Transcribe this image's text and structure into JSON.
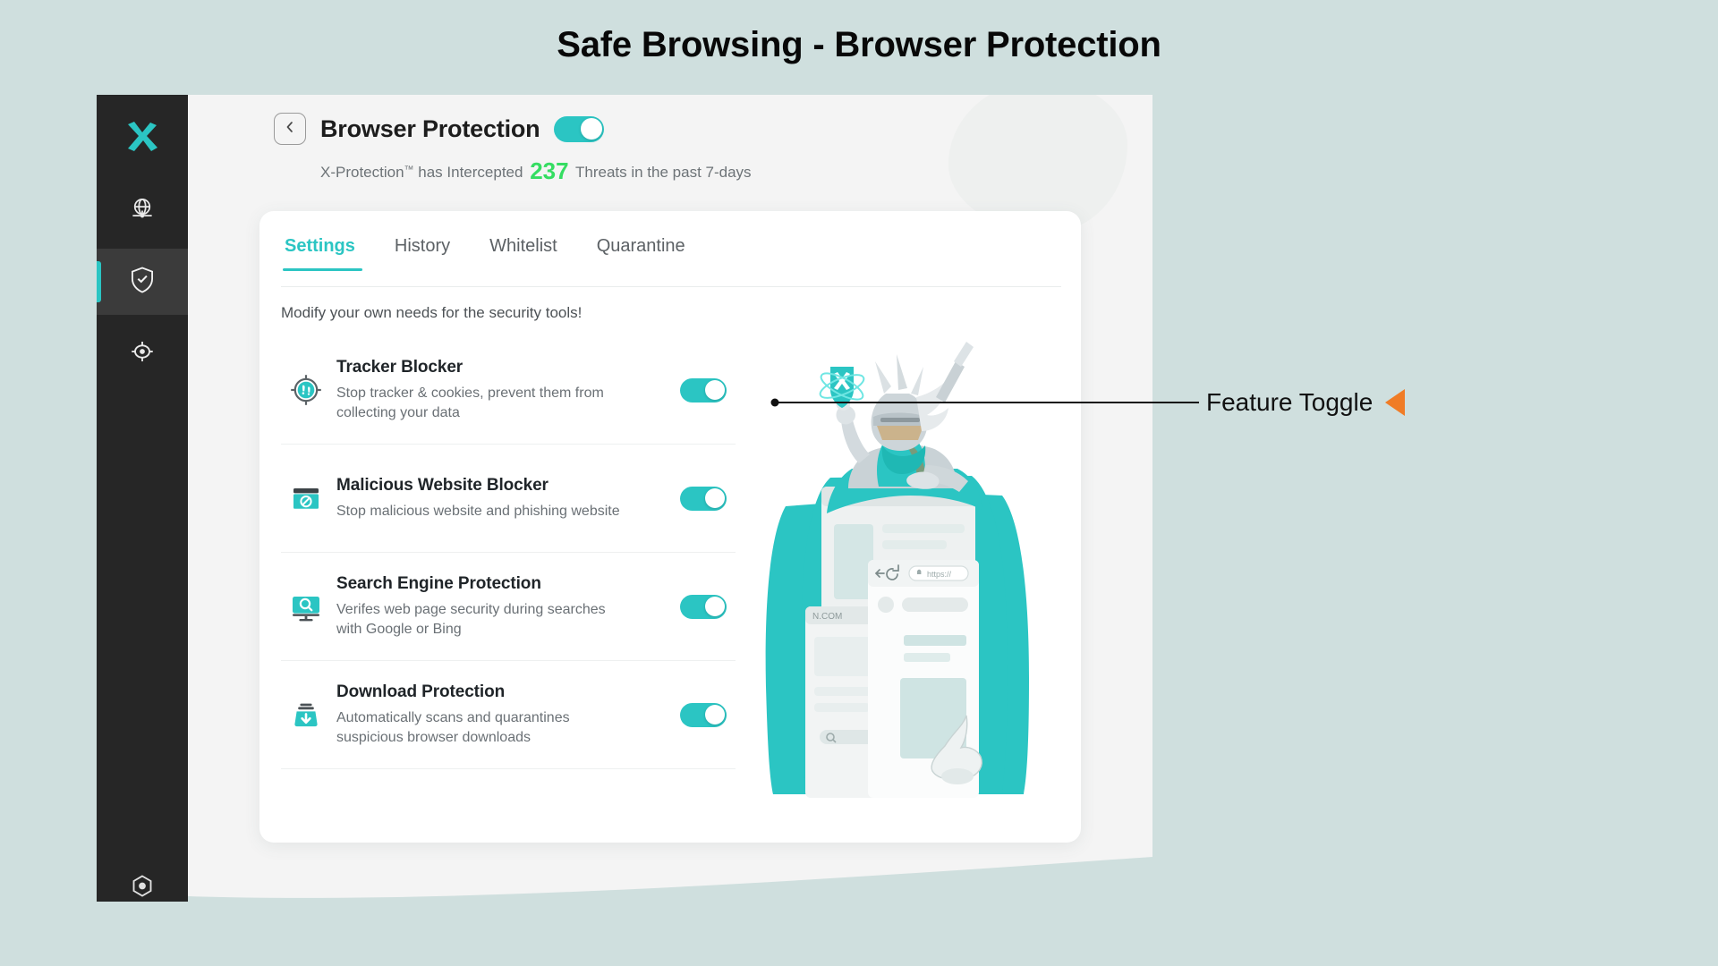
{
  "page": {
    "title": "Safe Browsing - Browser Protection",
    "background_color": "#cfdfde"
  },
  "colors": {
    "accent_teal": "#2bc5c3",
    "count_green": "#35dd62",
    "sidebar_dark": "#262626",
    "annotation_orange": "#f07c26"
  },
  "sidebar": {
    "items": [
      {
        "name": "logo",
        "icon": "x-logo-icon",
        "active": false
      },
      {
        "name": "web",
        "icon": "globe-icon",
        "active": false
      },
      {
        "name": "protection",
        "icon": "shield-check-icon",
        "active": true
      },
      {
        "name": "scan",
        "icon": "target-icon",
        "active": false
      },
      {
        "name": "settings",
        "icon": "gear-icon",
        "active": false
      }
    ]
  },
  "header": {
    "back_icon": "chevron-left-icon",
    "title": "Browser Protection",
    "master_toggle": {
      "label": "Browser Protection master toggle",
      "state": "on"
    },
    "subtitle_prefix": "X-Protection",
    "subtitle_tm": "™",
    "subtitle_mid": " has Intercepted ",
    "count": "237",
    "subtitle_suffix": " Threats in the past 7-days"
  },
  "tabs": [
    {
      "label": "Settings",
      "active": true
    },
    {
      "label": "History",
      "active": false
    },
    {
      "label": "Whitelist",
      "active": false
    },
    {
      "label": "Quarantine",
      "active": false
    }
  ],
  "main": {
    "modify_note": "Modify your own needs for the security tools!"
  },
  "features": [
    {
      "icon": "tracker-target-icon",
      "title": "Tracker Blocker",
      "desc": "Stop tracker & cookies, prevent them from collecting your data",
      "toggle": "on"
    },
    {
      "icon": "malicious-window-icon",
      "title": "Malicious Website Blocker",
      "desc": "Stop malicious website and phishing website",
      "toggle": "on"
    },
    {
      "icon": "search-monitor-icon",
      "title": "Search Engine Protection",
      "desc": "Verifes web page security during searches with Google or Bing",
      "toggle": "on"
    },
    {
      "icon": "download-tray-icon",
      "title": "Download Protection",
      "desc": "Automatically scans and quarantines suspicious browser downloads",
      "toggle": "on"
    }
  ],
  "illustration": {
    "name": "knight-guarding-browsers-illustration",
    "browser_label_1": ".COM",
    "browser_label_2": "N.COM",
    "url_text": "https://"
  },
  "annotation": {
    "label": "Feature Toggle",
    "arrow_icon": "left-triangle-icon"
  }
}
